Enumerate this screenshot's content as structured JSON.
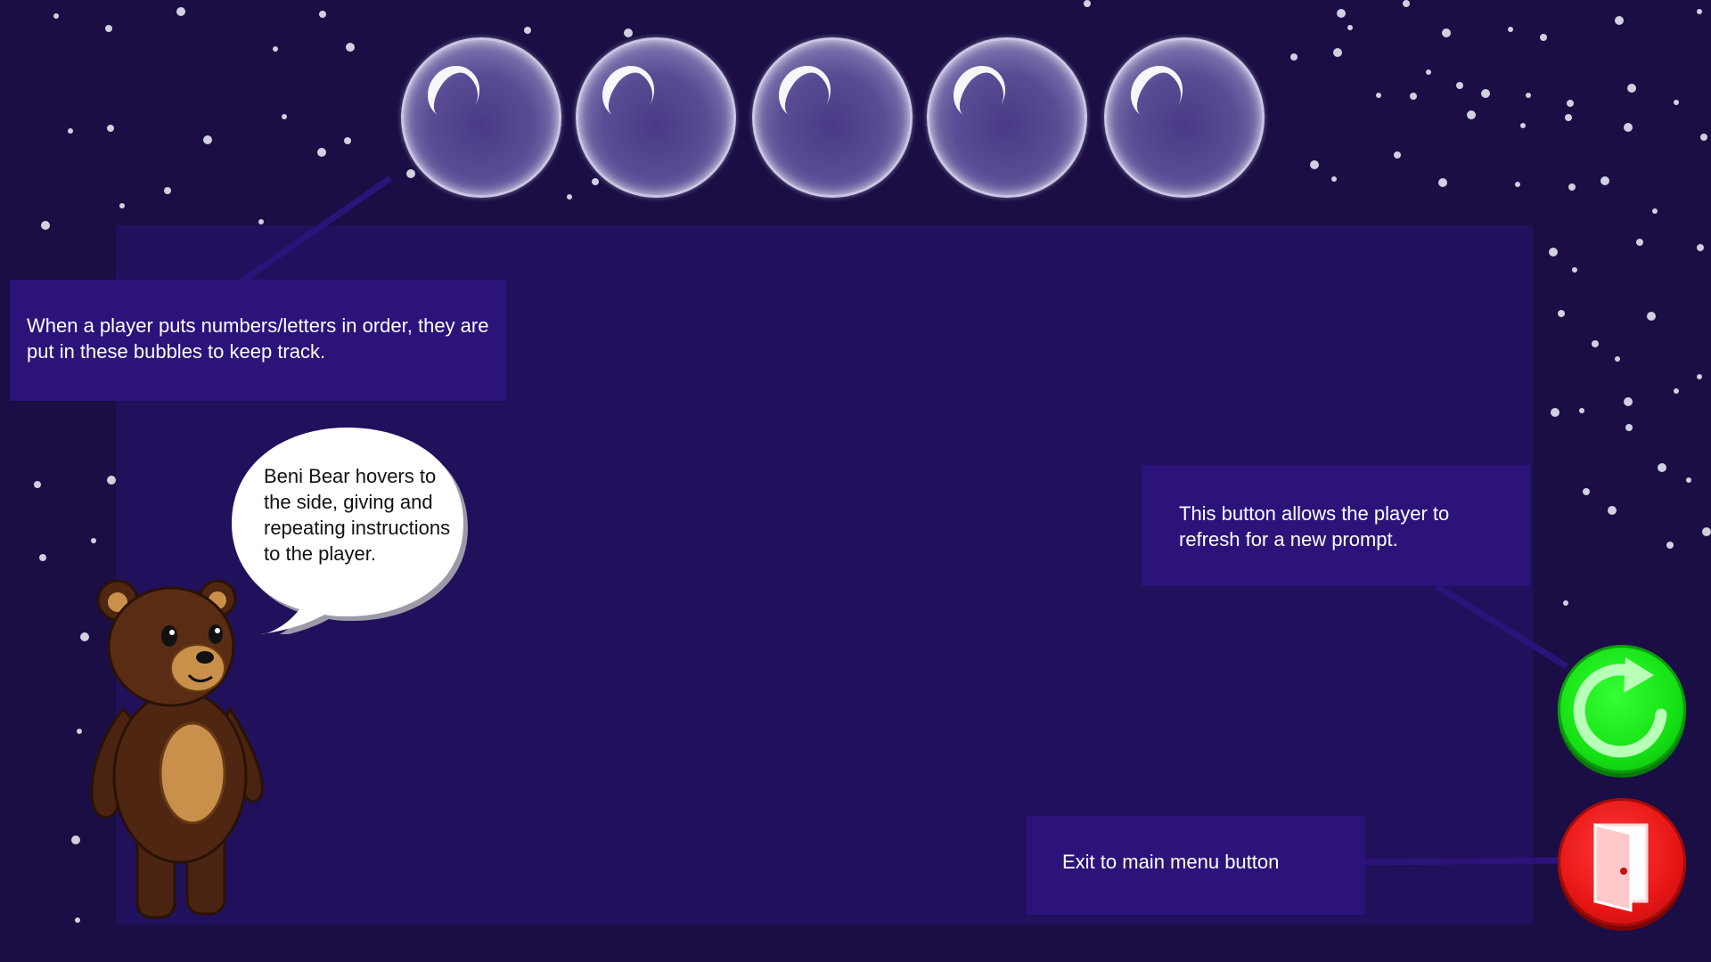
{
  "game": {
    "bubbles": [
      {
        "name": "tracking-bubble-1"
      },
      {
        "name": "tracking-bubble-2"
      },
      {
        "name": "tracking-bubble-3"
      },
      {
        "name": "tracking-bubble-4"
      },
      {
        "name": "tracking-bubble-5"
      }
    ],
    "character": {
      "speech": "Beni Bear hovers to the side, giving and repeating instructions to the player."
    },
    "buttons": {
      "refresh_icon": "refresh-icon",
      "exit_icon": "door-exit-icon"
    }
  },
  "annotations": {
    "bubbles_note": "When a player puts numbers/letters in order, they are put in these bubbles to keep track.",
    "refresh_note": "This button allows the player to refresh for a new prompt.",
    "exit_note": "Exit to main menu button"
  },
  "colors": {
    "background": "#1a0e45",
    "play_area": "#21105c",
    "callout": "#2c137a",
    "refresh_button": "#14e014",
    "exit_button": "#e61515"
  }
}
